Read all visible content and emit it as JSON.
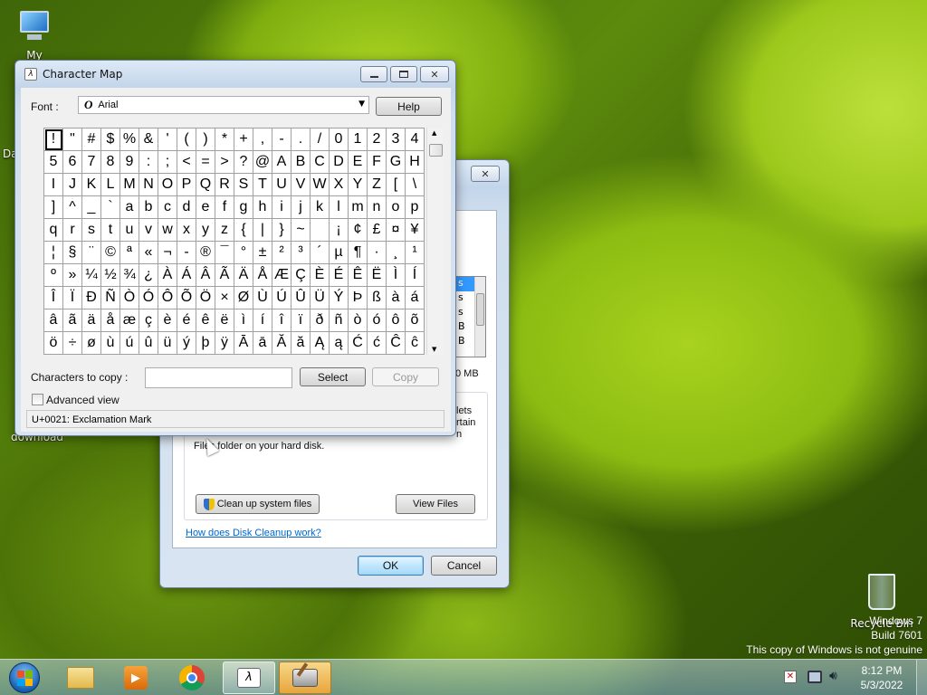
{
  "desktop": {
    "icons": {
      "computer": "My Computer",
      "recycle": "Recycle Bin",
      "download": "download",
      "partial_da": "Da"
    },
    "watermark": {
      "line1": "Windows 7",
      "line2": "Build 7601",
      "line3": "This copy of Windows is not genuine"
    }
  },
  "charmap": {
    "title": "Character Map",
    "font_label": "Font :",
    "font_value": "Arial",
    "help": "Help",
    "characters": [
      "!",
      "\"",
      "#",
      "$",
      "%",
      "&",
      "'",
      "(",
      ")",
      "*",
      "+",
      ",",
      "-",
      ".",
      "/",
      "0",
      "1",
      "2",
      "3",
      "4",
      "5",
      "6",
      "7",
      "8",
      "9",
      ":",
      ";",
      "<",
      "=",
      ">",
      "?",
      "@",
      "A",
      "B",
      "C",
      "D",
      "E",
      "F",
      "G",
      "H",
      "I",
      "J",
      "K",
      "L",
      "M",
      "N",
      "O",
      "P",
      "Q",
      "R",
      "S",
      "T",
      "U",
      "V",
      "W",
      "X",
      "Y",
      "Z",
      "[",
      "\\",
      "]",
      "^",
      "_",
      "`",
      "a",
      "b",
      "c",
      "d",
      "e",
      "f",
      "g",
      "h",
      "i",
      "j",
      "k",
      "l",
      "m",
      "n",
      "o",
      "p",
      "q",
      "r",
      "s",
      "t",
      "u",
      "v",
      "w",
      "x",
      "y",
      "z",
      "{",
      "|",
      "}",
      "~",
      " ",
      "¡",
      "¢",
      "£",
      "¤",
      "¥",
      "¦",
      "§",
      "¨",
      "©",
      "ª",
      "«",
      "¬",
      "-",
      "®",
      "¯",
      "°",
      "±",
      "²",
      "³",
      "´",
      "µ",
      "¶",
      "·",
      "¸",
      "¹",
      "º",
      "»",
      "¼",
      "½",
      "¾",
      "¿",
      "À",
      "Á",
      "Â",
      "Ã",
      "Ä",
      "Å",
      "Æ",
      "Ç",
      "È",
      "É",
      "Ê",
      "Ë",
      "Ì",
      "Í",
      "Î",
      "Ï",
      "Ð",
      "Ñ",
      "Ò",
      "Ó",
      "Ô",
      "Õ",
      "Ö",
      "×",
      "Ø",
      "Ù",
      "Ú",
      "Û",
      "Ü",
      "Ý",
      "Þ",
      "ß",
      "à",
      "á",
      "â",
      "ã",
      "ä",
      "å",
      "æ",
      "ç",
      "è",
      "é",
      "ê",
      "ë",
      "ì",
      "í",
      "î",
      "ï",
      "ð",
      "ñ",
      "ò",
      "ó",
      "ô",
      "õ",
      "ö",
      "÷",
      "ø",
      "ù",
      "ú",
      "û",
      "ü",
      "ý",
      "þ",
      "ÿ",
      "Ā",
      "ā",
      "Ă",
      "ă",
      "Ą",
      "ą",
      "Ć",
      "ć",
      "Ĉ",
      "ĉ"
    ],
    "copy_label": "Characters to copy :",
    "copy_value": "",
    "select": "Select",
    "copy": "Copy",
    "advanced": "Advanced view",
    "status": "U+0021: Exclamation Mark"
  },
  "cleanup": {
    "list_fragments": [
      "s",
      "s",
      "s",
      "B",
      "B"
    ],
    "size_fragment": "0 MB",
    "desc_fragments": [
      "lets",
      "rtain",
      "n"
    ],
    "desc_line": "Files folder on your hard disk.",
    "cleanup_system": "Clean up system files",
    "view_files": "View Files",
    "link": "How does Disk Cleanup work?",
    "ok": "OK",
    "cancel": "Cancel"
  },
  "taskbar": {
    "time": "8:12 PM",
    "date": "5/3/2022"
  }
}
